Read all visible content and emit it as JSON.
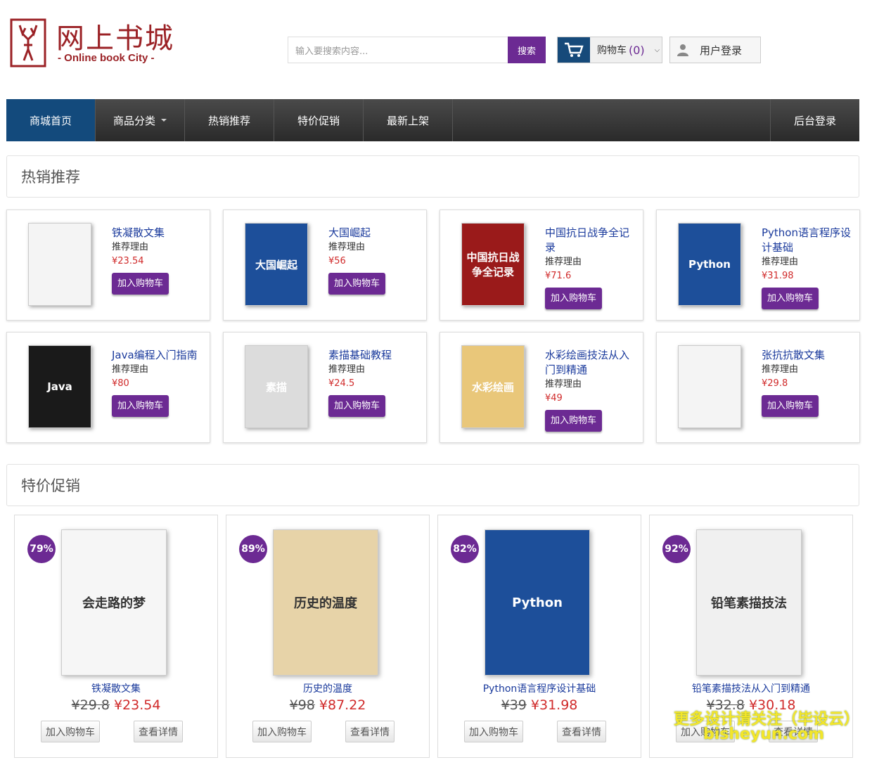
{
  "header": {
    "logo_cn": "网上书城",
    "logo_en": "- Online book City -",
    "search_placeholder": "输入要搜索内容...",
    "search_button": "搜索",
    "cart_label": "购物车",
    "cart_count": "(0)",
    "login_label": "用户登录"
  },
  "nav": {
    "items": [
      "商城首页",
      "商品分类",
      "热销推荐",
      "特价促销",
      "最新上架"
    ],
    "admin": "后台登录"
  },
  "hot": {
    "title": "热销推荐",
    "reason_label": "推荐理由",
    "button": "加入购物车",
    "items": [
      {
        "title": "铁凝散文集",
        "price": "¥23.54",
        "cover_color": "#f4f4f4"
      },
      {
        "title": "大国崛起",
        "price": "¥56",
        "cover_color": "#1d4f9a"
      },
      {
        "title": "中国抗日战争全记录",
        "price": "¥71.6",
        "cover_color": "#9a1a1a"
      },
      {
        "title": "Python语言程序设计基础",
        "price": "¥31.98",
        "cover_color": "#1d4f9a"
      },
      {
        "title": "Java编程入门指南",
        "price": "¥80",
        "cover_color": "#1a1a1a"
      },
      {
        "title": "素描基础教程",
        "price": "¥24.5",
        "cover_color": "#dcdcdc"
      },
      {
        "title": "水彩绘画技法从入门到精通",
        "price": "¥49",
        "cover_color": "#e9c77a"
      },
      {
        "title": "张抗抗散文集",
        "price": "¥29.8",
        "cover_color": "#f4f4f4"
      }
    ],
    "cover_text": {
      "1": "大国崛起",
      "2": "中国抗日战争全记录",
      "3": "Python",
      "4": "Java",
      "5": "素描",
      "6": "水彩绘画"
    }
  },
  "sale": {
    "title": "特价促销",
    "add_button": "加入购物车",
    "detail_button": "查看详情",
    "items": [
      {
        "title": "铁凝散文集",
        "old": "¥29.8",
        "new": "¥23.54",
        "badge": "79%",
        "cover_color": "#f6f6f6",
        "cover_text": "会走路的梦"
      },
      {
        "title": "历史的温度",
        "old": "¥98",
        "new": "¥87.22",
        "badge": "89%",
        "cover_color": "#e7d3a8",
        "cover_text": "历史的温度"
      },
      {
        "title": "Python语言程序设计基础",
        "old": "¥39",
        "new": "¥31.98",
        "badge": "82%",
        "cover_color": "#1d4f9a",
        "cover_text": "Python"
      },
      {
        "title": "铅笔素描技法从入门到精通",
        "old": "¥32.8",
        "new": "¥30.18",
        "badge": "92%",
        "cover_color": "#f0f0f0",
        "cover_text": "铅笔素描技法"
      }
    ]
  },
  "watermark": {
    "line1": "更多设计请关注（毕设云）",
    "line2": "bisheyun.com"
  }
}
